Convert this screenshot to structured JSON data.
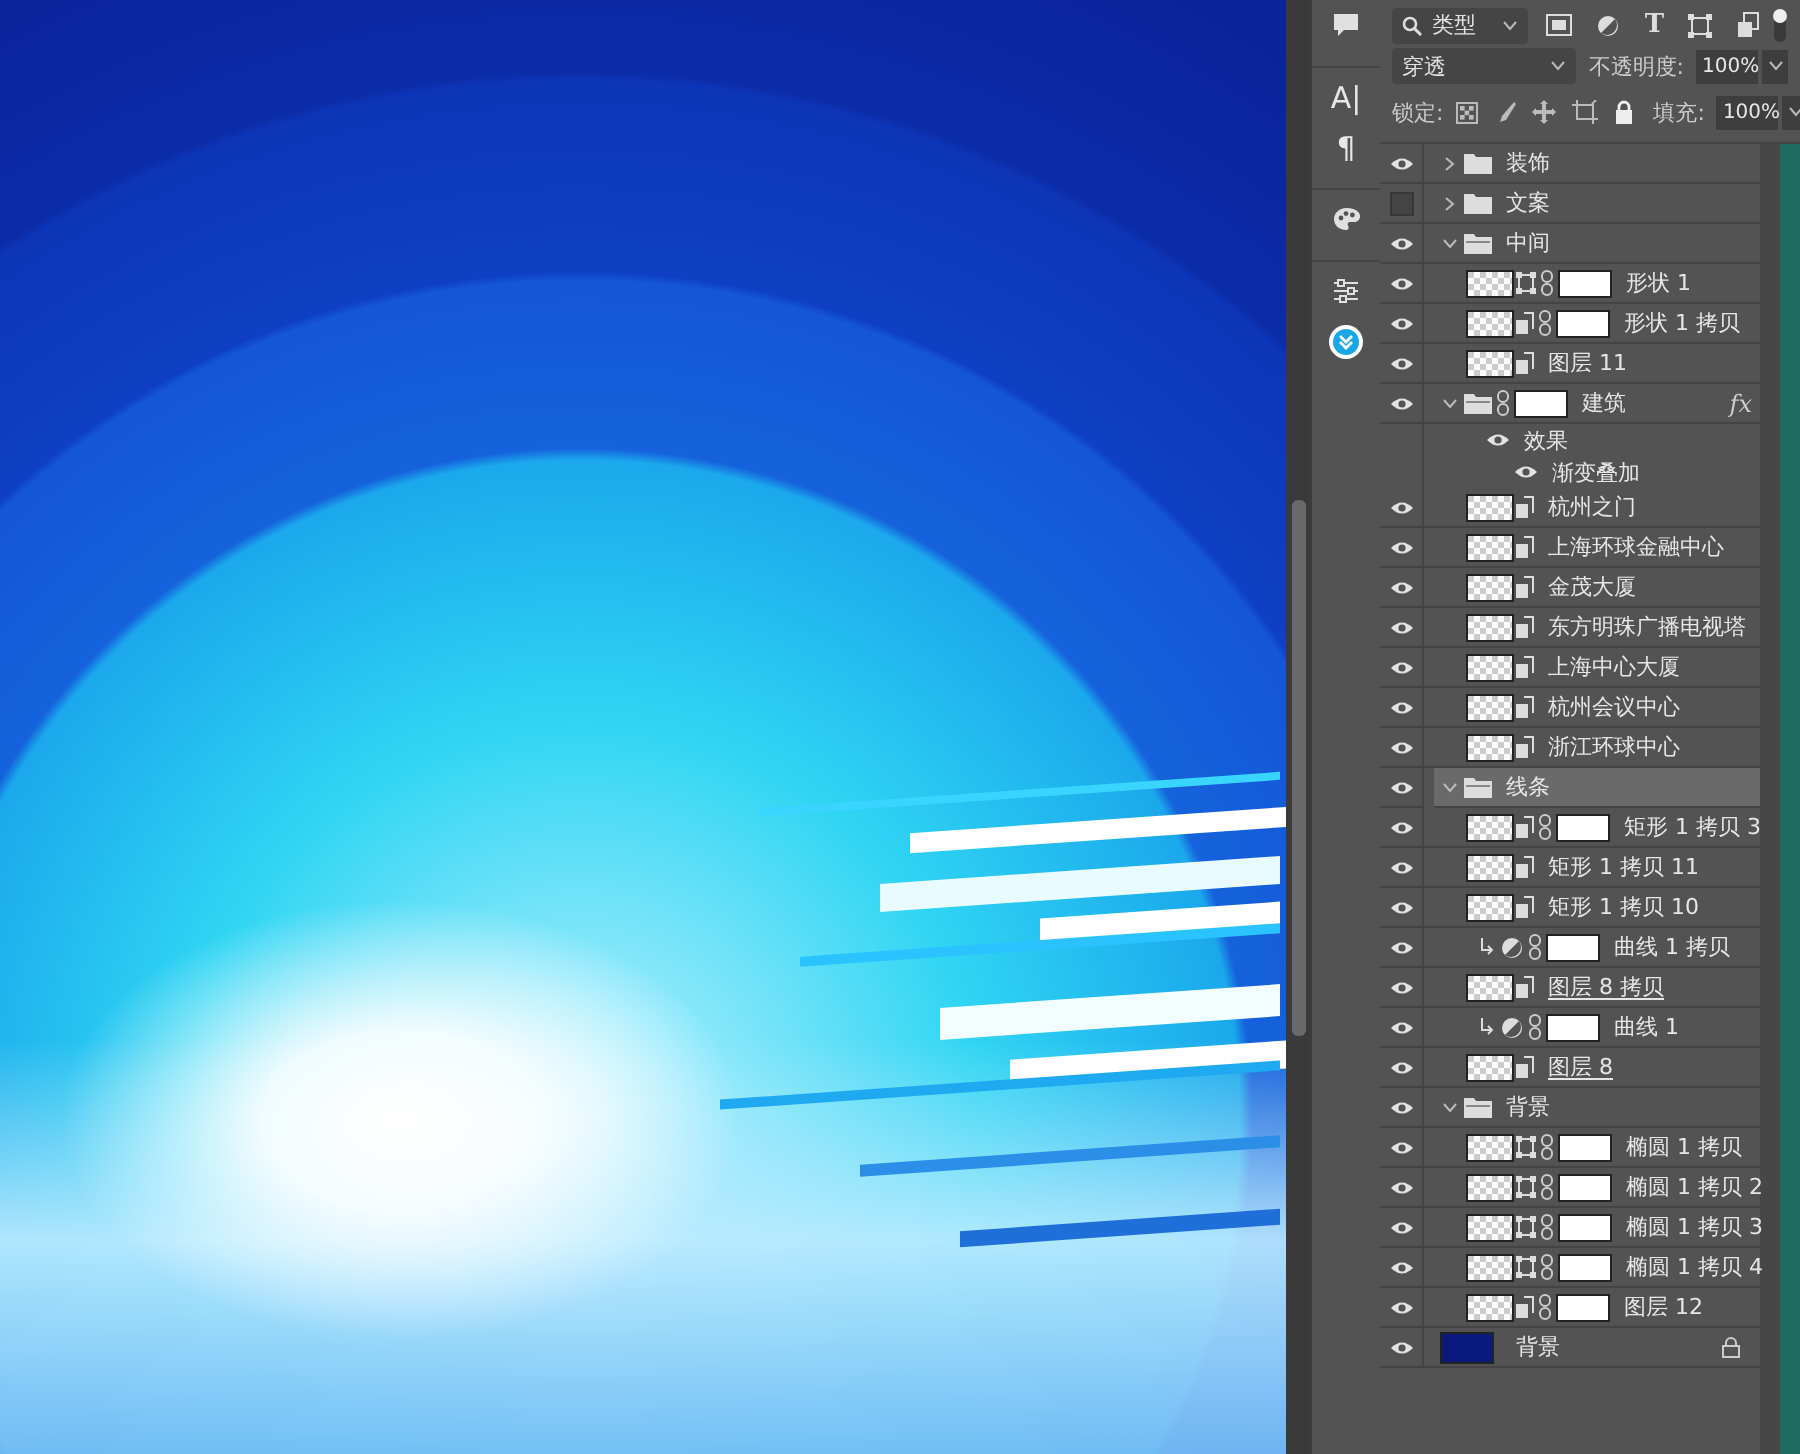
{
  "tool_strip": [
    {
      "kind": "comment"
    },
    {
      "kind": "glyph",
      "text": "A|"
    },
    {
      "kind": "glyph",
      "text": "¶"
    },
    {
      "kind": "palette"
    },
    {
      "kind": "sliders"
    },
    {
      "kind": "download"
    }
  ],
  "layers_panel": {
    "filter": {
      "value": "类型"
    },
    "filter_icons": [
      {
        "kind": "image"
      },
      {
        "kind": "adjustment"
      },
      {
        "kind": "type",
        "text": "T"
      },
      {
        "kind": "shape"
      },
      {
        "kind": "smart"
      }
    ],
    "filter_enabled": true,
    "blend_mode": "穿透",
    "opacity": {
      "label": "不透明度:",
      "value": "100%"
    },
    "lock_label": "锁定:",
    "fill": {
      "label": "填充:",
      "value": "100%"
    },
    "layers": [
      {
        "kind": "group",
        "name": "装饰",
        "visible": true,
        "selected": false,
        "expanded": false
      },
      {
        "kind": "group",
        "name": "文案",
        "visible": false,
        "selected": false,
        "expanded": false
      },
      {
        "kind": "group",
        "name": "中间",
        "visible": true,
        "selected": false,
        "expanded": true,
        "children": [
          {
            "kind": "shape",
            "name": "形状 1",
            "visible": true,
            "selected": false,
            "mask": true,
            "clipped": false,
            "clip_base": false
          },
          {
            "kind": "smart",
            "name": "形状 1 拷贝",
            "visible": true,
            "selected": false,
            "mask": true,
            "clipped": false,
            "clip_base": false
          },
          {
            "kind": "smart",
            "name": "图层 11",
            "visible": true,
            "selected": false,
            "mask": false,
            "clipped": false,
            "clip_base": false
          },
          {
            "kind": "group",
            "name": "建筑",
            "visible": true,
            "selected": false,
            "expanded": true,
            "mask": true,
            "fx_label": "fx",
            "effects": {
              "label": "效果",
              "visible": true,
              "items": [
                {
                  "name": "渐变叠加",
                  "visible": true
                }
              ]
            },
            "children": [
              {
                "kind": "smart",
                "name": "杭州之门",
                "visible": true,
                "selected": false,
                "mask": false,
                "clipped": false,
                "clip_base": false
              },
              {
                "kind": "smart",
                "name": "上海环球金融中心",
                "visible": true,
                "selected": false,
                "mask": false,
                "clipped": false,
                "clip_base": false
              },
              {
                "kind": "smart",
                "name": "金茂大厦",
                "visible": true,
                "selected": false,
                "mask": false,
                "clipped": false,
                "clip_base": false
              },
              {
                "kind": "smart",
                "name": "东方明珠广播电视塔",
                "visible": true,
                "selected": false,
                "mask": false,
                "clipped": false,
                "clip_base": false
              },
              {
                "kind": "smart",
                "name": "上海中心大厦",
                "visible": true,
                "selected": false,
                "mask": false,
                "clipped": false,
                "clip_base": false
              },
              {
                "kind": "smart",
                "name": "杭州会议中心",
                "visible": true,
                "selected": false,
                "mask": false,
                "clipped": false,
                "clip_base": false
              },
              {
                "kind": "smart",
                "name": "浙江环球中心",
                "visible": true,
                "selected": false,
                "mask": false,
                "clipped": false,
                "clip_base": false
              }
            ]
          },
          {
            "kind": "group",
            "name": "线条",
            "visible": true,
            "selected": true,
            "expanded": true,
            "children": [
              {
                "kind": "smart",
                "name": "矩形 1 拷贝 3",
                "visible": true,
                "selected": false,
                "mask": true,
                "clipped": false,
                "clip_base": false
              },
              {
                "kind": "smart",
                "name": "矩形 1 拷贝 11",
                "visible": true,
                "selected": false,
                "mask": false,
                "clipped": false,
                "clip_base": false
              },
              {
                "kind": "smart",
                "name": "矩形 1 拷贝 10",
                "visible": true,
                "selected": false,
                "mask": false,
                "clipped": false,
                "clip_base": false
              },
              {
                "kind": "adjustment",
                "name": "曲线 1 拷贝",
                "visible": true,
                "selected": false,
                "mask": true,
                "clipped": true,
                "clip_base": false
              },
              {
                "kind": "smart",
                "name": "图层 8 拷贝",
                "visible": true,
                "selected": false,
                "mask": false,
                "clipped": false,
                "clip_base": true
              },
              {
                "kind": "adjustment",
                "name": "曲线 1",
                "visible": true,
                "selected": false,
                "mask": true,
                "clipped": true,
                "clip_base": false
              },
              {
                "kind": "smart",
                "name": "图层 8",
                "visible": true,
                "selected": false,
                "mask": false,
                "clipped": false,
                "clip_base": true
              }
            ]
          }
        ]
      },
      {
        "kind": "group",
        "name": "背景",
        "visible": true,
        "selected": false,
        "expanded": true,
        "children": [
          {
            "kind": "shape",
            "name": "椭圆 1 拷贝",
            "visible": true,
            "selected": false,
            "mask": true,
            "clipped": false,
            "clip_base": false
          },
          {
            "kind": "shape",
            "name": "椭圆 1 拷贝 2",
            "visible": true,
            "selected": false,
            "mask": true,
            "clipped": false,
            "clip_base": false
          },
          {
            "kind": "shape",
            "name": "椭圆 1 拷贝 3",
            "visible": true,
            "selected": false,
            "mask": true,
            "clipped": false,
            "clip_base": false
          },
          {
            "kind": "shape",
            "name": "椭圆 1 拷贝 4",
            "visible": true,
            "selected": false,
            "mask": true,
            "clipped": false,
            "clip_base": false
          },
          {
            "kind": "smart",
            "name": "图层 12",
            "visible": true,
            "selected": false,
            "mask": true,
            "clipped": false,
            "clip_base": false
          }
        ]
      },
      {
        "kind": "background",
        "name": "背景",
        "visible": true,
        "selected": false,
        "locked": true
      }
    ]
  }
}
